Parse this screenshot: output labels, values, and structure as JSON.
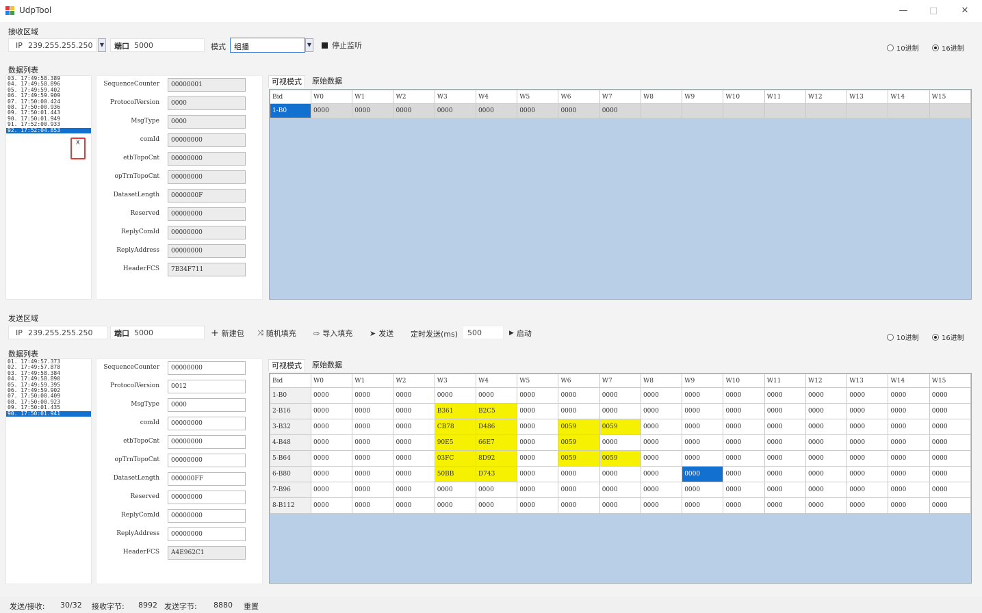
{
  "window": {
    "title": "UdpTool",
    "minimize": "—",
    "maximize": "□",
    "close": "✕"
  },
  "receive": {
    "section_label": "接收区域",
    "ip_label": "IP",
    "ip_value": "239.255.255.250",
    "port_label": "端口",
    "port_value": "5000",
    "mode_label": "模式",
    "mode_value": "组播",
    "stop_label": "停止监听",
    "radio_hex10": "10进制",
    "radio_hex16": "16进制",
    "list_label": "数据列表",
    "list_items": [
      "03. 17:49:58.389",
      "04. 17:49:58.896",
      "05. 17:49:59.402",
      "06. 17:49:59.909",
      "07. 17:50:00.424",
      "08. 17:50:00.936",
      "09. 17:50:01.443",
      "90. 17:50:01.949",
      "91. 17:52:00.933",
      "92. 17:52:04.853"
    ],
    "marker_glyph": "X",
    "header_fields": [
      {
        "label": "SequenceCounter",
        "value": "00000001"
      },
      {
        "label": "ProtocolVersion",
        "value": "0000"
      },
      {
        "label": "MsgType",
        "value": "0000"
      },
      {
        "label": "comId",
        "value": "00000000"
      },
      {
        "label": "etbTopoCnt",
        "value": "00000000"
      },
      {
        "label": "opTrnTopoCnt",
        "value": "00000000"
      },
      {
        "label": "DatasetLength",
        "value": "0000000F"
      },
      {
        "label": "Reserved",
        "value": "00000000"
      },
      {
        "label": "ReplyComId",
        "value": "00000000"
      },
      {
        "label": "ReplyAddress",
        "value": "00000000"
      },
      {
        "label": "HeaderFCS",
        "value": "7B34F711"
      }
    ],
    "tab_visual": "可视模式",
    "tab_raw": "原始数据",
    "grid_columns": [
      "Bid",
      "W0",
      "W1",
      "W2",
      "W3",
      "W4",
      "W5",
      "W6",
      "W7",
      "W8",
      "W9",
      "W10",
      "W11",
      "W12",
      "W13",
      "W14",
      "W15"
    ],
    "grid_rows": [
      [
        "1-B0",
        "0000",
        "0000",
        "0000",
        "0000",
        "0000",
        "0000",
        "0000",
        "0000",
        "",
        "",
        "",
        "",
        "",
        "",
        "",
        ""
      ]
    ]
  },
  "send": {
    "section_label": "发送区域",
    "ip_label": "IP",
    "ip_value": "239.255.255.250",
    "port_label": "端口",
    "port_value": "5000",
    "btn_new": "新建包",
    "btn_random": "随机填充",
    "btn_import": "导入填充",
    "btn_send": "发送",
    "timer_label": "定时发送(ms)",
    "timer_value": "500",
    "btn_start": "启动",
    "radio_hex10": "10进制",
    "radio_hex16": "16进制",
    "list_label": "数据列表",
    "list_items": [
      "01. 17:49:57.373",
      "02. 17:49:57.878",
      "03. 17:49:58.384",
      "04. 17:49:58.890",
      "05. 17:49:59.395",
      "06. 17:49:59.902",
      "07. 17:50:00.409",
      "08. 17:50:00.923",
      "09. 17:50:01.435",
      "90. 17:50:01.941"
    ],
    "header_fields": [
      {
        "label": "SequenceCounter",
        "value": "00000000"
      },
      {
        "label": "ProtocolVersion",
        "value": "0012"
      },
      {
        "label": "MsgType",
        "value": "0000"
      },
      {
        "label": "comId",
        "value": "00000000"
      },
      {
        "label": "etbTopoCnt",
        "value": "00000000"
      },
      {
        "label": "opTrnTopoCnt",
        "value": "00000000"
      },
      {
        "label": "DatasetLength",
        "value": "000000FF"
      },
      {
        "label": "Reserved",
        "value": "00000000"
      },
      {
        "label": "ReplyComId",
        "value": "00000000"
      },
      {
        "label": "ReplyAddress",
        "value": "00000000"
      },
      {
        "label": "HeaderFCS",
        "value": "A4E962C1"
      }
    ],
    "tab_visual": "可视模式",
    "tab_raw": "原始数据",
    "grid_columns": [
      "Bid",
      "W0",
      "W1",
      "W2",
      "W3",
      "W4",
      "W5",
      "W6",
      "W7",
      "W8",
      "W9",
      "W10",
      "W11",
      "W12",
      "W13",
      "W14",
      "W15"
    ],
    "grid_rows": [
      [
        "1-B0",
        "0000",
        "0000",
        "0000",
        "0000",
        "0000",
        "0000",
        "0000",
        "0000",
        "0000",
        "0000",
        "0000",
        "0000",
        "0000",
        "0000",
        "0000",
        "0000"
      ],
      [
        "2-B16",
        "0000",
        "0000",
        "0000",
        "B361",
        "B2C5",
        "0000",
        "0000",
        "0000",
        "0000",
        "0000",
        "0000",
        "0000",
        "0000",
        "0000",
        "0000",
        "0000"
      ],
      [
        "3-B32",
        "0000",
        "0000",
        "0000",
        "CB78",
        "D486",
        "0000",
        "0059",
        "0059",
        "0000",
        "0000",
        "0000",
        "0000",
        "0000",
        "0000",
        "0000",
        "0000"
      ],
      [
        "4-B48",
        "0000",
        "0000",
        "0000",
        "90E5",
        "66E7",
        "0000",
        "0059",
        "0000",
        "0000",
        "0000",
        "0000",
        "0000",
        "0000",
        "0000",
        "0000",
        "0000"
      ],
      [
        "5-B64",
        "0000",
        "0000",
        "0000",
        "03FC",
        "8D92",
        "0000",
        "0059",
        "0059",
        "0000",
        "0000",
        "0000",
        "0000",
        "0000",
        "0000",
        "0000",
        "0000"
      ],
      [
        "6-B80",
        "0000",
        "0000",
        "0000",
        "50BB",
        "D743",
        "0000",
        "0000",
        "0000",
        "0000",
        "0000",
        "0000",
        "0000",
        "0000",
        "0000",
        "0000",
        "0000"
      ],
      [
        "7-B96",
        "0000",
        "0000",
        "0000",
        "0000",
        "0000",
        "0000",
        "0000",
        "0000",
        "0000",
        "0000",
        "0000",
        "0000",
        "0000",
        "0000",
        "0000",
        "0000"
      ],
      [
        "8-B112",
        "0000",
        "0000",
        "0000",
        "0000",
        "0000",
        "0000",
        "0000",
        "0000",
        "0000",
        "0000",
        "0000",
        "0000",
        "0000",
        "0000",
        "0000",
        "0000"
      ]
    ]
  },
  "status_bar": {
    "send_recv_label": "发送/接收:",
    "send_recv_value": "30/32",
    "recv_bytes_label": "接收字节:",
    "recv_bytes_value": "8992",
    "send_bytes_label": "发送字节:",
    "send_bytes_value": "8880",
    "reset_label": "重置"
  },
  "colors": {
    "accent": "#1170d0",
    "highlight": "#f5f100",
    "grid_bg": "#b9cfe8",
    "marker": "#e53935"
  }
}
